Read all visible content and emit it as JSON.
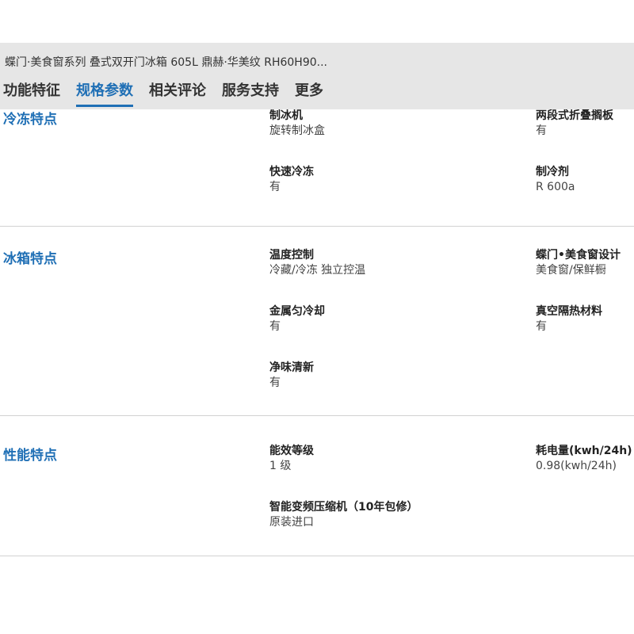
{
  "header": {
    "product_title": "蝶门·美食窗系列 叠式双开门冰箱 605L 鼎赫·华美纹 RH60H90...",
    "tabs": [
      {
        "label": "功能特征"
      },
      {
        "label": "规格参数",
        "active": true
      },
      {
        "label": "相关评论"
      },
      {
        "label": "服务支持"
      },
      {
        "label": "更多"
      }
    ]
  },
  "sections": [
    {
      "title": "冷冻特点",
      "specs": [
        {
          "label": "制冰机",
          "value": "旋转制冰盒"
        },
        {
          "label": "两段式折叠搁板",
          "value": "有"
        },
        {
          "label": "快速冷冻",
          "value": "有"
        },
        {
          "label": "制冷剂",
          "value": "R 600a"
        }
      ]
    },
    {
      "title": "冰箱特点",
      "specs": [
        {
          "label": "温度控制",
          "value": "冷藏/冷冻 独立控温"
        },
        {
          "label": "蝶门•美食窗设计",
          "value": "美食窗/保鲜橱"
        },
        {
          "label": "金属匀冷却",
          "value": "有"
        },
        {
          "label": "真空隔热材料",
          "value": "有"
        },
        {
          "label": "净味清新",
          "value": "有"
        }
      ]
    },
    {
      "title": "性能特点",
      "specs": [
        {
          "label": "能效等级",
          "value": "1 级"
        },
        {
          "label": "耗电量(kwh/24h)",
          "value": "0.98(kwh/24h)"
        },
        {
          "label": "智能变频压缩机（10年包修）",
          "value": "原装进口"
        }
      ]
    }
  ],
  "colors": {
    "accent": "#1f6fb5",
    "header_bg": "#e6e6e6",
    "divider": "#d2d2d2"
  }
}
